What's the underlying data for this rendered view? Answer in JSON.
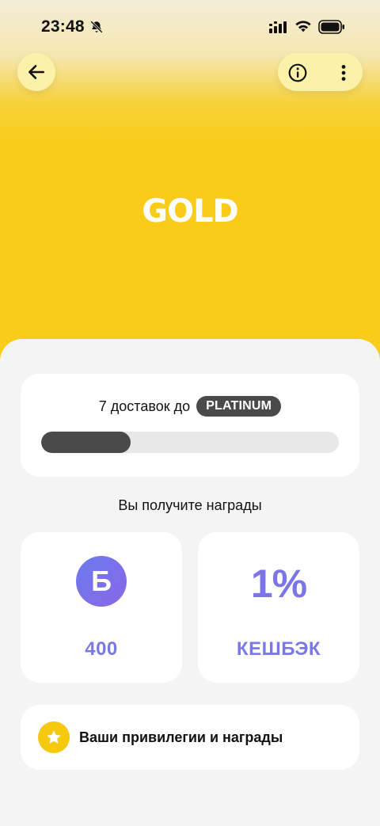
{
  "status_bar": {
    "time": "23:48"
  },
  "header": {
    "logo_text": "GOLD",
    "colors": {
      "brand_yellow": "#F8CC18",
      "button_bg": "#FBF1A8"
    },
    "buttons": {
      "back_icon": "arrow-left-icon",
      "info_icon": "info-icon",
      "more_icon": "more-vertical-icon"
    }
  },
  "progress": {
    "text": "7 доставок до",
    "tier": "PLATINUM",
    "fraction": 0.3
  },
  "rewards": {
    "title": "Вы получите награды",
    "bonus_icon_letter": "Б",
    "bonus_value": "400",
    "cashback_percent": "1%",
    "cashback_label": "КЕШБЭК"
  },
  "privileges": {
    "label": "Ваши привилегии и награды",
    "icon": "star-icon"
  }
}
